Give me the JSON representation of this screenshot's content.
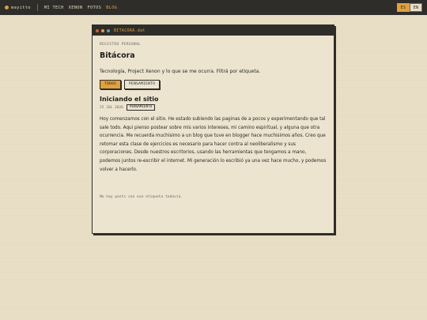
{
  "topbar": {
    "brand": "mayitto",
    "nav": [
      {
        "label": "MI TECH",
        "active": false
      },
      {
        "label": "XENON",
        "active": false
      },
      {
        "label": "FOTOS",
        "active": false
      },
      {
        "label": "BLOG",
        "active": true
      }
    ],
    "lang": {
      "es": "ES",
      "en": "EN"
    }
  },
  "window": {
    "filename": "BITACORA.dat",
    "kicker": "REGISTRO PERSONAL",
    "title": "Bitácora",
    "intro": "Tecnología, Project Xenon y lo que se me ocurra. Filtrá por etiqueta.",
    "filters": [
      "TODOS",
      "PENSAMIENTO"
    ],
    "post": {
      "title": "Iniciando el sitio",
      "date": "25 JUL 2026",
      "tag": "PENSAMIENTO",
      "body": "Hoy comenzamos con el sitio. He estado subiendo las paginas de a pocos y experimentando que tal sale todo. Aqui pienso postear sobre mis varios intereses, mi camino espiritual, y alguna que otra ocurrencia. Me recuerda muchisimo a un blog que tuve en blogger hace muchisimos años. Creo que retomar esta clase de ejercicios es necesario para hacer contra al neoliberalismo y sus corporaciones. Desde nuestros escritorios, usando las herramientas que tengamos a mano, podemos juntos re-escribir el internet. Mi generación lo escribió ya una vez hace mucho, y podemos volver a hacerlo."
    },
    "empty_message": "No hay posts con esa etiqueta todavía."
  },
  "colors": {
    "accent": "#e0a13a",
    "bar": "#2e2d29",
    "paper": "#ece4cf",
    "background": "#e8dfc6"
  }
}
